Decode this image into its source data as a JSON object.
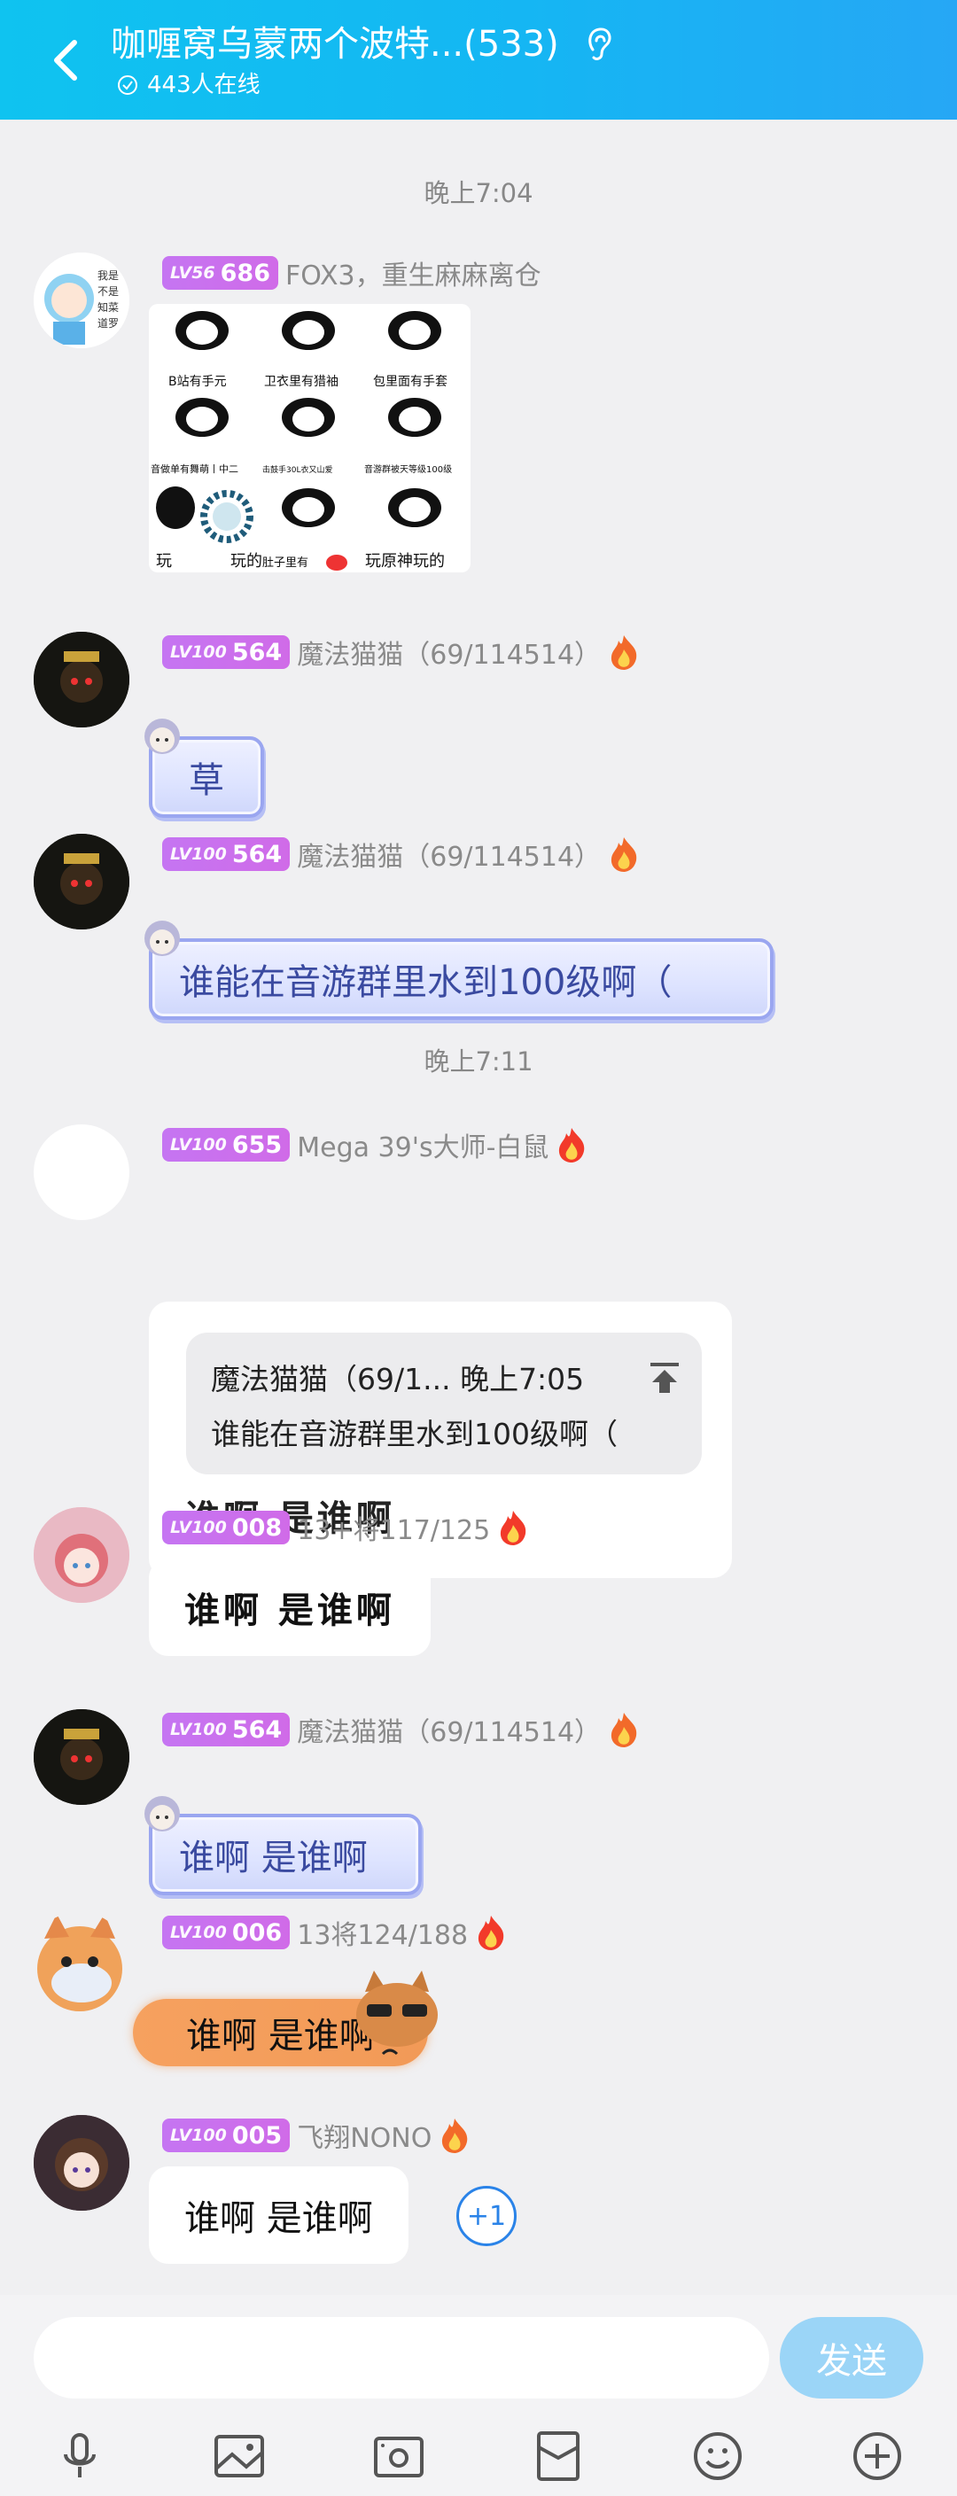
{
  "header": {
    "title": "咖喱窝乌蒙两个波特...(533)",
    "online": "443人在线"
  },
  "times": [
    "晚上7:04",
    "晚上7:11"
  ],
  "messages": [
    {
      "level": "LV56",
      "score": "686",
      "nick": "FOX3，重生麻麻离仓",
      "sticker_labels": [
        "B站有手元",
        "卫衣里有猎袖",
        "包里面有手套",
        "音做单有舞萌丨中二",
        "击鼓手30L衣又山爱",
        "音游群被天等级100级",
        "玩",
        "玩的",
        "肚子里有",
        "玩原神玩的"
      ]
    },
    {
      "level": "LV100",
      "score": "564",
      "nick": "魔法猫猫（69/114514）",
      "text": "草"
    },
    {
      "level": "LV100",
      "score": "564",
      "nick": "魔法猫猫（69/114514）",
      "text": "谁能在音游群里水到100级啊（"
    },
    {
      "level": "LV100",
      "score": "655",
      "nick": "Mega 39's大师-白鼠",
      "quote_head": "魔法猫猫（69/1... 晚上7:05",
      "quote_text": "谁能在音游群里水到100级啊（",
      "text": "谁啊 是谁啊"
    },
    {
      "level": "LV100",
      "score": "008",
      "nick": "13+将117/125",
      "text": "谁啊 是谁啊"
    },
    {
      "level": "LV100",
      "score": "564",
      "nick": "魔法猫猫（69/114514）",
      "text": "谁啊 是谁啊"
    },
    {
      "level": "LV100",
      "score": "006",
      "nick": "13将124/188",
      "text": "谁啊 是谁啊"
    },
    {
      "level": "LV100",
      "score": "005",
      "nick": "飞翔NONO",
      "text": "谁啊 是谁啊",
      "plus_one": "+1"
    }
  ],
  "input": {
    "placeholder": "",
    "send_label": "发送"
  },
  "toolbar_icons": [
    "microphone-icon",
    "image-icon",
    "camera-icon",
    "red-packet-icon",
    "emoji-icon",
    "plus-icon"
  ],
  "colors": {
    "header_start": "#0fc3f0",
    "header_end": "#26a7f5",
    "badge": "#c575f2",
    "send_button": "#9bd5f7",
    "plus_one": "#2a83e8"
  }
}
